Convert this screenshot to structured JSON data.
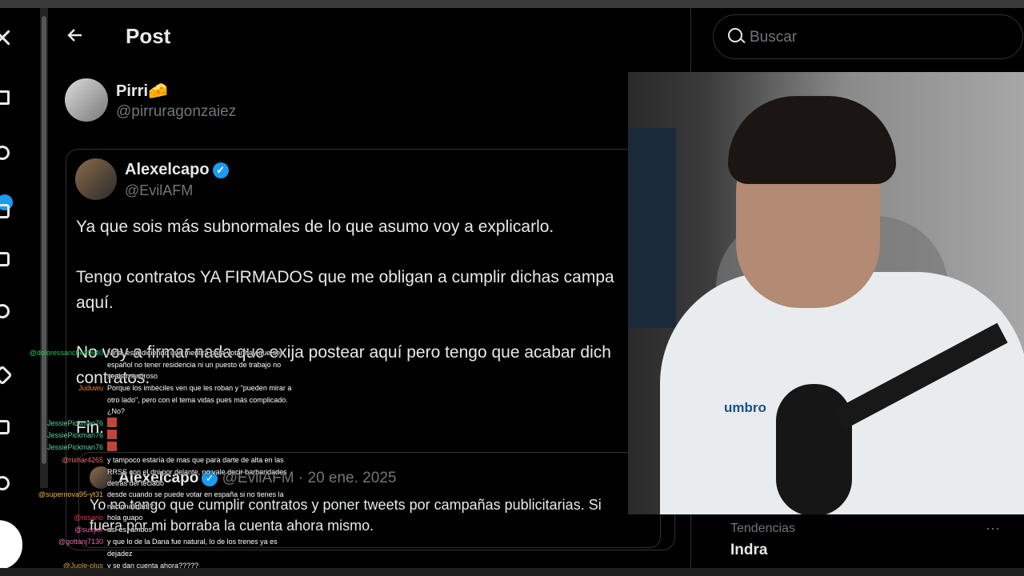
{
  "header": {
    "title": "Post",
    "back_icon": "arrow-left-icon"
  },
  "author": {
    "name": "Pirri",
    "emoji": "🧀",
    "handle": "@pirruragonzaiez"
  },
  "quoted": {
    "name": "Alexelcapo",
    "handle": "@EvilAFM",
    "lines": [
      "Ya que sois más subnormales de lo que asumo voy a explicarlo.",
      "Tengo contratos YA FIRMADOS que me obligan a cumplir dichas campa",
      "aquí.",
      "No voy a firmar nada que exija postear aquí pero tengo que acabar dich",
      "contratos.",
      "Fin."
    ],
    "inner": {
      "name": "Alexelcapo",
      "handle": "@EvilAFM",
      "date": "· 20 ene. 2025",
      "lines": [
        "Yo no tengo que cumplir contratos y poner tweets por campañas publicitarias. Si",
        "fuera por mi borraba la cuenta ahora mismo."
      ]
    }
  },
  "search": {
    "placeholder": "Buscar"
  },
  "trends": {
    "label": "Tendencias",
    "item": "Indra"
  },
  "webcam": {
    "shirt_logo": "umbro"
  },
  "chat": [
    {
      "user": "@doloressanchez9640",
      "color": "#22c55e",
      "text": "Niña, está diciendo una mentira para votar hay que ser español no tener residencia ni un puesto de trabajo no seais mentiroso"
    },
    {
      "user": "Juduwu",
      "color": "#e8823a",
      "text": "Porque los imbéciles ven que les roban y \"pueden mirar a otro lado\", pero con el tema vidas pues más complicado. ¿No?"
    },
    {
      "user": "JessiePickman76",
      "color": "#5ad2a0",
      "text": ""
    },
    {
      "user": "JessiePickman76",
      "color": "#5ad2a0",
      "text": ""
    },
    {
      "user": "JessiePickman76",
      "color": "#5ad2a0",
      "text": ""
    },
    {
      "user": "@rixhar4265",
      "color": "#ef6a6a",
      "text": "y tampoco estaría de mas que para darte de alta en las RRSS con el dni por delante, no vale decir barbaridades detrás del teclado"
    },
    {
      "user": "@supernova95-yt31",
      "color": "#f0b23a",
      "text": "desde cuando se puede votar en españa si no tienes la nacionalidad ?"
    },
    {
      "user": "@rosario",
      "color": "#e03b3b",
      "text": "hola guapo"
    },
    {
      "user": "@susyer",
      "color": "#e86aa8",
      "text": "así es, ambos"
    },
    {
      "user": "@gottanj7130",
      "color": "#e86aa8",
      "text": "y que lo de la Dana fue natural, lo de los trenes ya es dejadez"
    },
    {
      "user": "@Juole-plus",
      "color": "#d6a53a",
      "text": "y se dan cuenta ahora?????"
    }
  ]
}
